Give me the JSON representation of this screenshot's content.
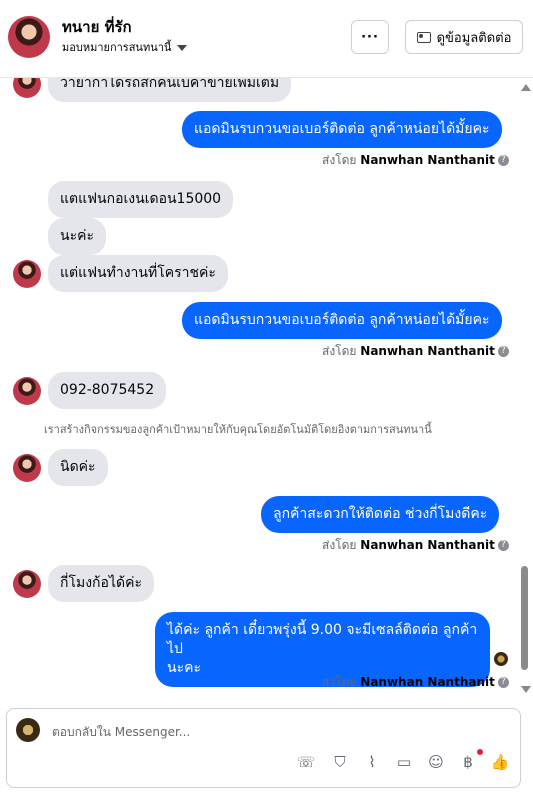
{
  "header": {
    "name": "ทนาย ที่รัก",
    "assigned": "มอบหมายการสนทนานี้",
    "more_label": "···",
    "contact_label": "ดูข้อมูลติดต่อ"
  },
  "messages": [
    {
      "text": "วายากาไดรถสกคนเบคาขายเพมเตม"
    },
    {
      "text": "แอดมินรบกวนขอเบอร์ติดต่อ ลูกค้าหน่อยได้มั้ยคะ"
    },
    {
      "text": "แตแฟนกอเงนเดอน15000"
    },
    {
      "text": "นะค่ะ"
    },
    {
      "text": "แต่แฟนทำงานที่โคราชค่ะ"
    },
    {
      "text": "แอดมินรบกวนขอเบอร์ติดต่อ ลูกค้าหน่อยได้มั้ยคะ"
    },
    {
      "text": "092-8075452"
    },
    {
      "text": "นิดค่ะ"
    },
    {
      "text": "ลูกค้าสะดวกให้ติดต่อ ช่วงกี่โมงดีคะ"
    },
    {
      "text": "กี่โมงก้อได้ค่ะ"
    },
    {
      "text": "ได้ค่ะ ลูกค้า เดี๋ยวพรุ่งนี้ 9.00 จะมีเซลล์ติดต่อ ลูกค้าไป"
    },
    {
      "text": "นะคะ"
    }
  ],
  "sent_by": {
    "prefix": "ส่งโดย",
    "name": "Nanwhan Nanthanit",
    "info": "?"
  },
  "system_note": "เราสร้างกิจกรรมของลูกค้าเป้าหมายให้กับคุณโดยอัตโนมัติโดยอิงตามการสนทนานี้",
  "composer": {
    "placeholder": "ตอบกลับใน Messenger..."
  },
  "icons": {
    "phone": "☏",
    "bag": "⛉",
    "clip": "⌇",
    "chat": "▭",
    "emoji": "☺",
    "baht": "฿",
    "like": "👍"
  }
}
